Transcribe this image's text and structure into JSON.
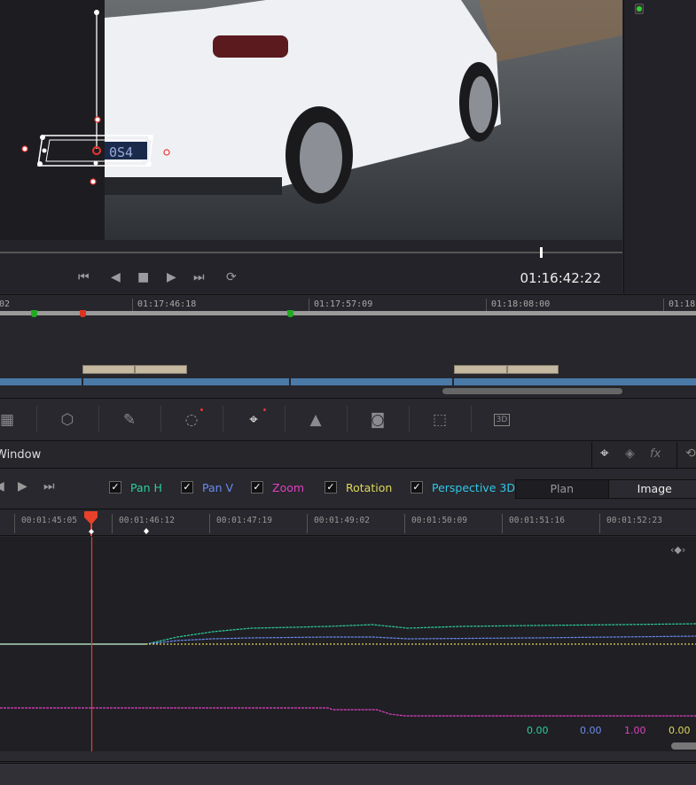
{
  "viewer": {
    "plate_text": "0S4",
    "timecode": "01:16:42:22"
  },
  "transport": {
    "buttons": [
      "skip-to-start",
      "play-reverse",
      "stop",
      "play",
      "skip-to-end",
      "loop"
    ]
  },
  "timeline": {
    "labels": [
      "02",
      "01:17:46:18",
      "01:17:57:09",
      "01:18:08:00",
      "01:18:"
    ]
  },
  "toolbar": {
    "tools": [
      "curves",
      "qualifier",
      "eyedropper",
      "window",
      "tracker",
      "blur",
      "key",
      "sizing",
      "3d"
    ],
    "three_d_label": "3D"
  },
  "panel": {
    "title": "Window"
  },
  "controls": {
    "params": [
      {
        "label": "Pan H",
        "color": "#2ecf9a",
        "checked": true
      },
      {
        "label": "Pan V",
        "color": "#6b8cf0",
        "checked": true
      },
      {
        "label": "Zoom",
        "color": "#e040c0",
        "checked": true
      },
      {
        "label": "Rotation",
        "color": "#e0d85a",
        "checked": true
      },
      {
        "label": "Perspective 3D",
        "color": "#30c8e8",
        "checked": true
      }
    ],
    "check_glyph": "✓",
    "mode_plan": "Plan",
    "mode_image": "Image",
    "active_mode": "Image"
  },
  "ruler": {
    "labels": [
      "00:01:45:05",
      "00:01:46:12",
      "00:01:47:19",
      "00:01:49:02",
      "00:01:50:09",
      "00:01:51:16",
      "00:01:52:23"
    ]
  },
  "graph": {
    "values": [
      {
        "v": "0.00",
        "color": "#2ecf9a"
      },
      {
        "v": "0.00",
        "color": "#6b8cf0"
      },
      {
        "v": "1.00",
        "color": "#e040c0"
      },
      {
        "v": "0.00",
        "color": "#e0d85a"
      }
    ]
  },
  "colors": {
    "playhead": "#e8402a",
    "accent_blue": "#4a7aa8"
  }
}
